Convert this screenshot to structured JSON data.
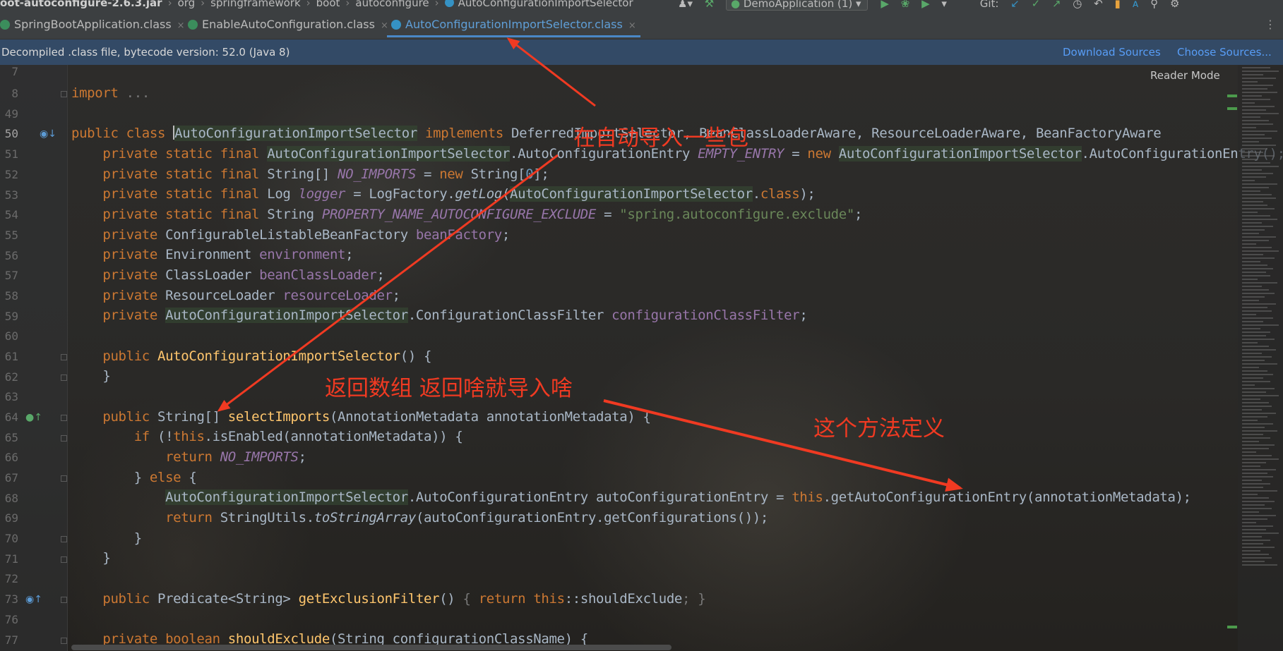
{
  "breadcrumb": {
    "items": [
      "oot-autoconfigure-2.6.3.jar",
      "org",
      "springframework",
      "boot",
      "autoconfigure",
      "AutoConfigurationImportSelector"
    ]
  },
  "toolbar": {
    "run_config": "DemoApplication (1)",
    "git_label": "Git:"
  },
  "tabs": [
    {
      "label": "SpringBootApplication.class",
      "close": "×"
    },
    {
      "label": "EnableAutoConfiguration.class",
      "close": "×"
    },
    {
      "label": "AutoConfigurationImportSelector.class",
      "close": "×"
    }
  ],
  "banner": {
    "message": "Decompiled .class file, bytecode version: 52.0 (Java 8)",
    "download_sources": "Download Sources",
    "choose_sources": "Choose Sources..."
  },
  "editor": {
    "reader_mode": "Reader Mode",
    "line_numbers": [
      "7",
      "8",
      "49",
      "50",
      "51",
      "52",
      "53",
      "54",
      "55",
      "56",
      "57",
      "58",
      "59",
      "60",
      "61",
      "62",
      "63",
      "64",
      "65",
      "66",
      "67",
      "68",
      "69",
      "70",
      "71",
      "72",
      "73",
      "76",
      "77"
    ],
    "current_line": "50"
  },
  "annotations": [
    "在自动导入一些包",
    "返回数组 返回啥就导入啥",
    "这个方法定义"
  ],
  "colors": {
    "keyword": "#cc7832",
    "field": "#9876aa",
    "string": "#6a8759",
    "number": "#6897bb",
    "method_decl": "#ffc66d",
    "annotation_red": "#f03a22",
    "banner_bg": "#334a66",
    "link": "#589df6"
  },
  "icons": [
    "class-icon",
    "run-icon",
    "debug-icon",
    "git-update-icon",
    "git-commit-icon",
    "search-icon",
    "settings-icon",
    "implements-gutter-icon",
    "overrides-gutter-icon"
  ]
}
